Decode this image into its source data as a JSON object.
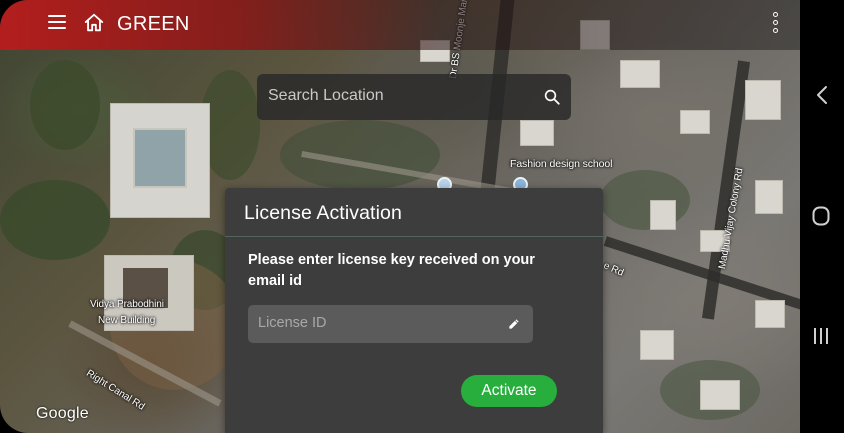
{
  "app": {
    "title": "GREEN",
    "accent_color": "#b91c1c"
  },
  "search": {
    "placeholder": "Search Location"
  },
  "map": {
    "labels": {
      "road_1": "Dr BS Moonje Marg",
      "place_1": "Fashion design school",
      "road_2": "Madhu Vijay Colony Rd",
      "road_3": "e Rd",
      "building_1": "Vidya Prabodhini",
      "building_2": "New Building",
      "road_4": "Right Canal Rd"
    },
    "attribution": "Google"
  },
  "dialog": {
    "title": "License Activation",
    "message": "Please enter license key received on your email id",
    "license_placeholder": "License ID",
    "activate_label": "Activate",
    "button_color": "#27ae3c"
  },
  "icons": {
    "menu": "menu-icon",
    "home": "home-icon",
    "overflow": "more-vertical-icon",
    "search": "search-icon",
    "edit": "pencil-icon",
    "back": "chevron-left-icon",
    "nav_home": "circle-home-icon",
    "recents": "recents-icon"
  }
}
